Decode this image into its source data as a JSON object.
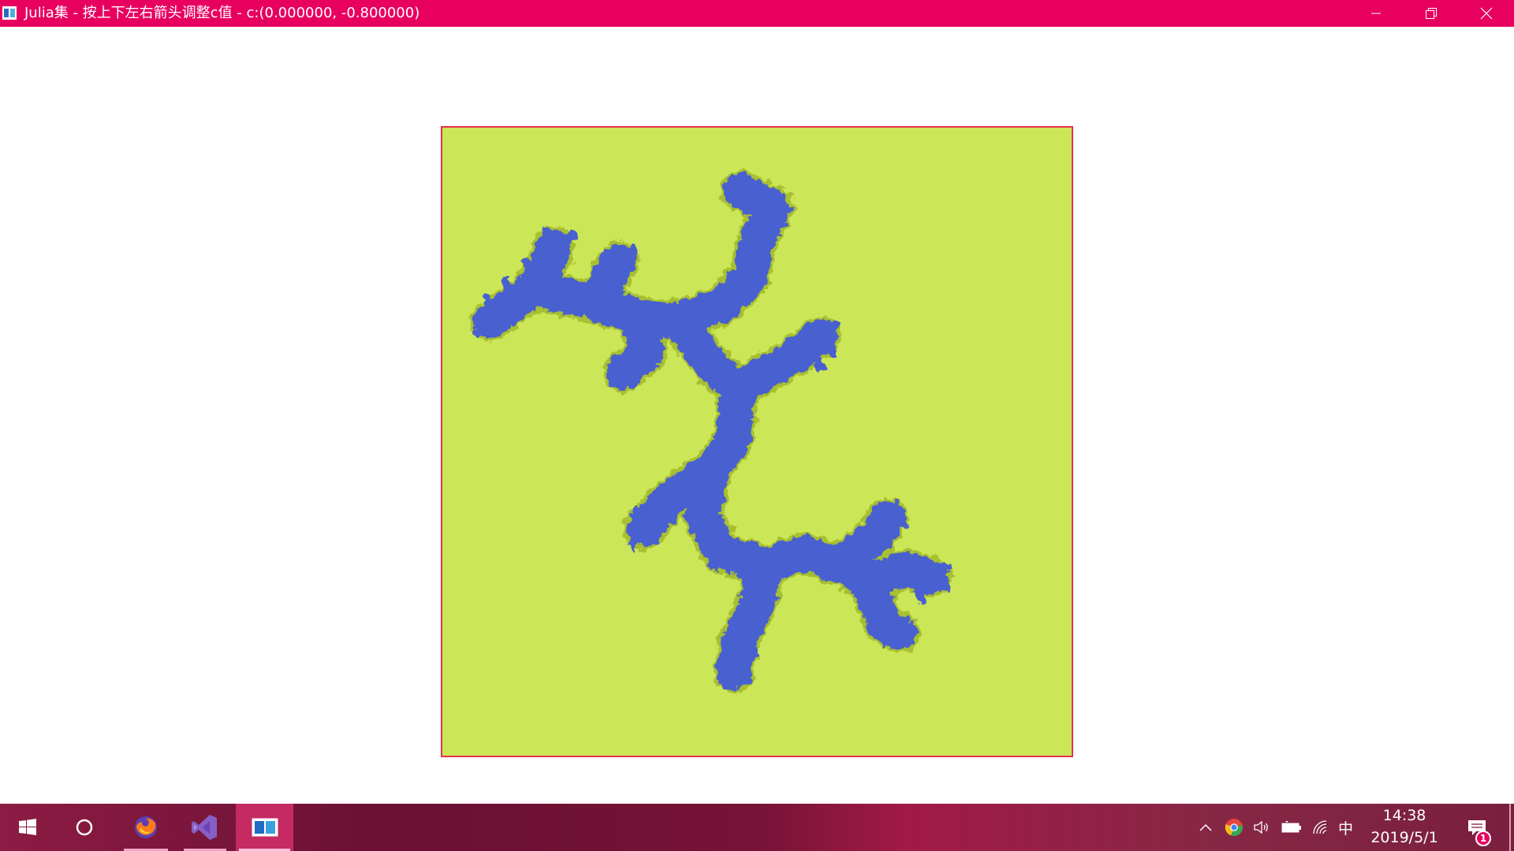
{
  "window": {
    "title": "Julia集 - 按上下左右箭头调整c值 - c:(0.000000, -0.800000)",
    "buttons": {
      "minimize": "minimize-icon",
      "restore": "restore-icon",
      "close": "close-icon"
    }
  },
  "canvas": {
    "background_color": "#cbe656",
    "fractal_color": "#4a61d0",
    "edge_color": "#a8bf32",
    "border_color": "#e5304a"
  },
  "taskbar": {
    "items": [
      {
        "icon": "windows-start-icon"
      },
      {
        "icon": "cortana-search-icon"
      },
      {
        "icon": "firefox-icon"
      },
      {
        "icon": "visual-studio-icon"
      },
      {
        "icon": "julia-app-icon"
      }
    ],
    "tray": {
      "icons": [
        "chevron-up-icon",
        "chrome-icon",
        "volume-icon",
        "battery-icon",
        "wifi-icon"
      ],
      "ime": "中"
    },
    "clock": {
      "time": "14:38",
      "date": "2019/5/1"
    },
    "notification_count": "1",
    "colors": {
      "accent": "#e8005f"
    }
  }
}
